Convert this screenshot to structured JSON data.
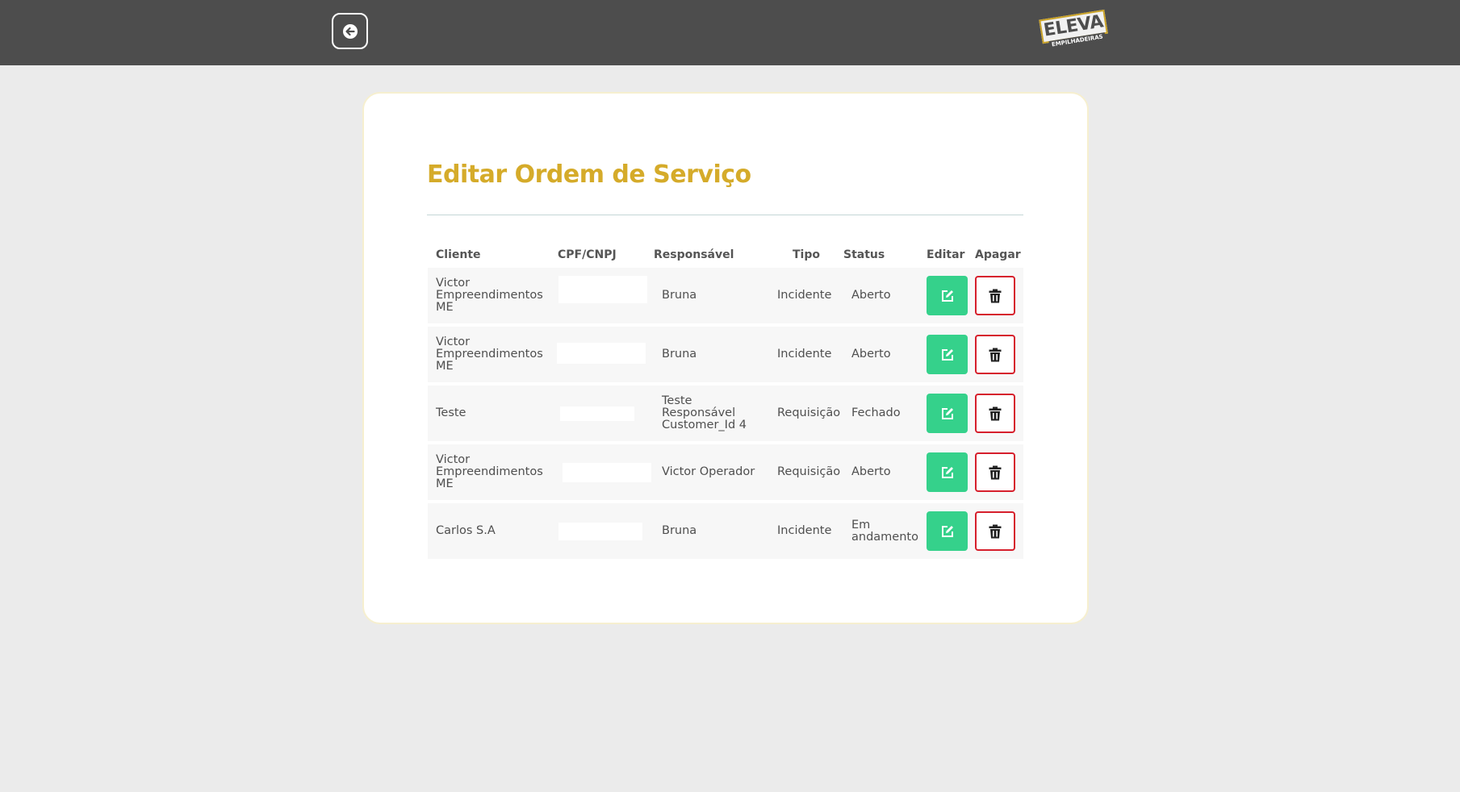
{
  "header": {
    "back_icon": "arrow-left-icon",
    "logo": {
      "text": "ELEVA",
      "subtext": "EMPILHADEIRAS",
      "accent_color": "#c9a227"
    }
  },
  "main": {
    "title": "Editar Ordem de Serviço",
    "title_color": "#d5ab2a",
    "table": {
      "columns": [
        "Cliente",
        "CPF/CNPJ",
        "Responsável",
        "Tipo",
        "Status",
        "Editar",
        "Apagar"
      ],
      "rows": [
        {
          "cliente": "Victor Empreendimentos ME",
          "cpf_cnpj": "",
          "responsavel": "Bruna",
          "tipo": "Incidente",
          "status": "Aberto"
        },
        {
          "cliente": "Victor Empreendimentos ME",
          "cpf_cnpj": "",
          "responsavel": "Bruna",
          "tipo": "Incidente",
          "status": "Aberto"
        },
        {
          "cliente": "Teste",
          "cpf_cnpj": "",
          "responsavel": "Teste Responsável Customer_Id 4",
          "tipo": "Requisição",
          "status": "Fechado"
        },
        {
          "cliente": "Victor Empreendimentos ME",
          "cpf_cnpj": "",
          "responsavel": "Victor Operador",
          "tipo": "Requisição",
          "status": "Aberto"
        },
        {
          "cliente": "Carlos S.A",
          "cpf_cnpj": "",
          "responsavel": "Bruna",
          "tipo": "Incidente",
          "status": "Em andamento"
        }
      ]
    },
    "edit_icon": "pencil-square-icon",
    "delete_icon": "trash-icon",
    "colors": {
      "edit_button": "#35d18b",
      "delete_border": "#d61f2c",
      "header_bar": "#4d4d4d",
      "background": "#ebebeb"
    }
  }
}
